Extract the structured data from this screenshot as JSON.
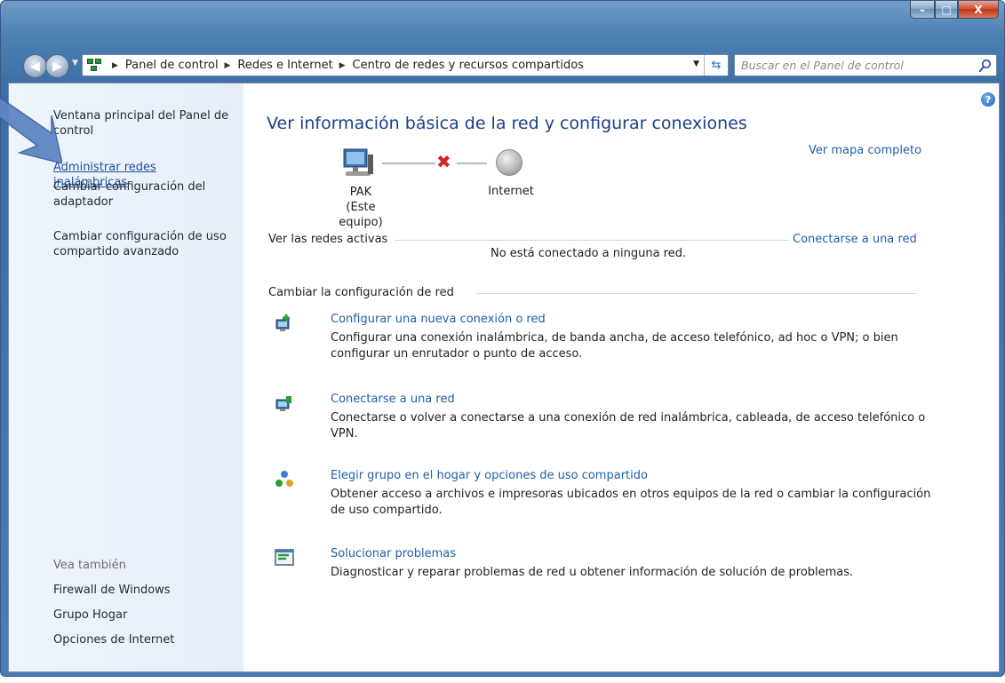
{
  "window": {
    "caption": {
      "minimize": "–",
      "maximize": "□",
      "close": "X"
    }
  },
  "address": {
    "crumbs": [
      "Panel de control",
      "Redes e Internet",
      "Centro de redes y recursos compartidos"
    ]
  },
  "search": {
    "placeholder": "Buscar en el Panel de control"
  },
  "sidebar": {
    "home": "Ventana principal del Panel de control",
    "links": [
      "Administrar redes inalámbricas",
      "Cambiar configuración del adaptador",
      "Cambiar configuración de uso compartido avanzado"
    ],
    "see_also_title": "Vea también",
    "see_also": [
      "Firewall de Windows",
      "Grupo Hogar",
      "Opciones de Internet"
    ]
  },
  "main": {
    "title": "Ver información básica de la red y configurar conexiones",
    "full_map": "Ver mapa completo",
    "computer_name": "PAK",
    "computer_sub": "(Este equipo)",
    "internet_label": "Internet",
    "active_networks_head": "Ver las redes activas",
    "connect_link": "Conectarse a una red",
    "no_network": "No está conectado a ninguna red.",
    "change_settings_head": "Cambiar la configuración de red",
    "tasks": [
      {
        "title": "Configurar una nueva conexión o red",
        "desc": "Configurar una conexión inalámbrica, de banda ancha, de acceso telefónico, ad hoc o VPN; o bien configurar un enrutador o punto de acceso."
      },
      {
        "title": "Conectarse a una red",
        "desc": "Conectarse o volver a conectarse a una conexión de red inalámbrica, cableada, de acceso telefónico o VPN."
      },
      {
        "title": "Elegir grupo en el hogar y opciones de uso compartido",
        "desc": "Obtener acceso a archivos e impresoras ubicados en otros equipos de la red o cambiar la configuración de uso compartido."
      },
      {
        "title": "Solucionar problemas",
        "desc": "Diagnosticar y reparar problemas de red u obtener información de solución de problemas."
      }
    ]
  },
  "colors": {
    "link": "#1f5fa8",
    "title": "#1a3f8a",
    "disconnect": "#d22424"
  }
}
